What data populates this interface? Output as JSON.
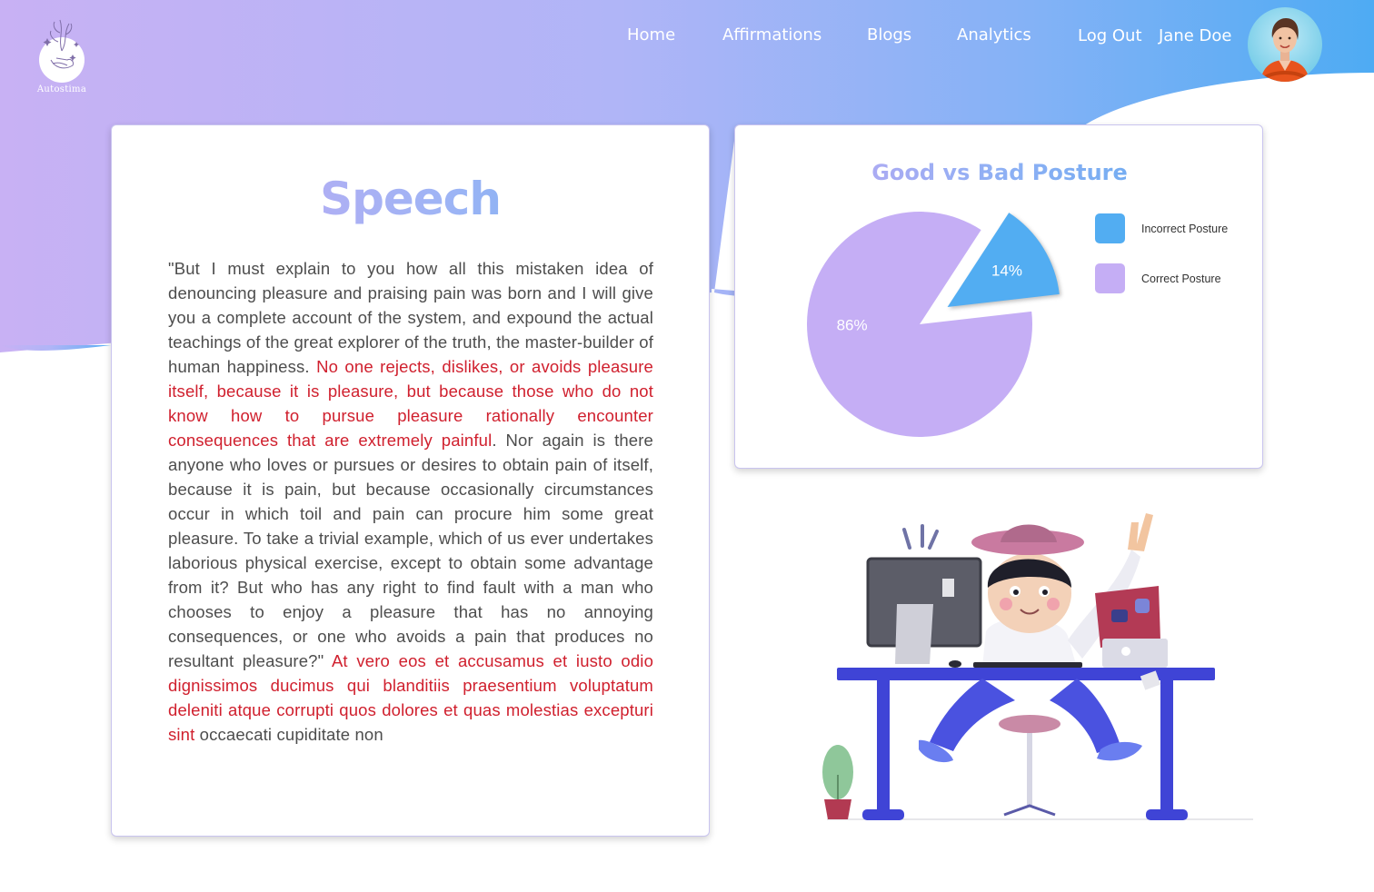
{
  "brand": {
    "name": "Autostima"
  },
  "nav": {
    "items": [
      {
        "label": "Home"
      },
      {
        "label": "Affirmations"
      },
      {
        "label": "Blogs"
      },
      {
        "label": "Analytics"
      },
      {
        "label": "Log Out"
      }
    ],
    "user_name": "Jane Doe"
  },
  "colors": {
    "purple": "#c5aef5",
    "blue": "#52adf2",
    "highlight_red": "#d0202e"
  },
  "speech": {
    "title": "Speech",
    "segments": [
      {
        "text": "\"But I must explain to you how all this mistaken idea of denouncing pleasure and praising pain was born and I will give you a complete account of the system, and expound the actual teachings of the great explorer of the truth, the master-builder of human happiness. ",
        "highlight": false
      },
      {
        "text": "No one rejects, dislikes, or avoids pleasure itself, because it is pleasure, but because those who do not know how to pursue pleasure rationally encounter consequences that are extremely painful",
        "highlight": true
      },
      {
        "text": ". Nor again is there anyone who loves or pursues or desires to obtain pain of itself, because it is pain, but because occasionally circumstances occur in which toil and pain can procure him some great pleasure. To take a trivial example, which of us ever undertakes laborious physical exercise, except to obtain some advantage from it? But who has any right to find fault with a man who chooses to enjoy a pleasure that has no annoying consequences, or one who avoids a pain that produces no resultant pleasure?\" ",
        "highlight": false
      },
      {
        "text": "At vero eos et accusamus et iusto odio dignissimos ducimus qui blanditiis praesentium voluptatum deleniti atque corrupti quos dolores et quas molestias excepturi sint",
        "highlight": true
      },
      {
        "text": " occaecati cupiditate non",
        "highlight": false
      }
    ]
  },
  "chart_data": {
    "type": "pie",
    "title": "Good vs Bad Posture",
    "series": [
      {
        "name": "Incorrect Posture",
        "value": 14,
        "label": "14%",
        "color": "#52adf2",
        "exploded": true
      },
      {
        "name": "Correct Posture",
        "value": 86,
        "label": "86%",
        "color": "#c5aef5",
        "exploded": false
      }
    ],
    "legend_position": "right"
  },
  "illustration": {
    "icon": "person-at-desk-illustration"
  }
}
